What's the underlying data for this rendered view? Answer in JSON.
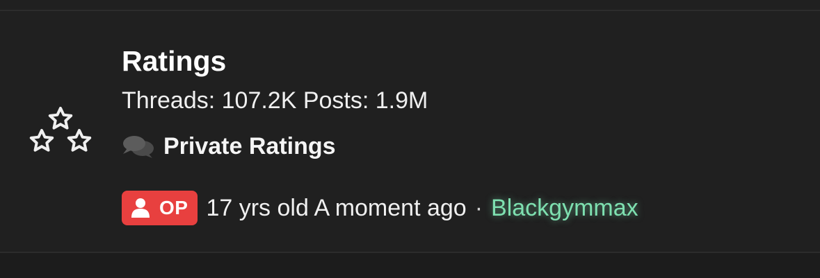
{
  "forum": {
    "title": "Ratings",
    "stats": "Threads: 107.2K Posts: 1.9M",
    "icon": "stars-icon",
    "subforum": {
      "icon": "chat-bubbles-icon",
      "label": "Private Ratings"
    },
    "last_post": {
      "badge_icon": "user-icon",
      "badge_label": "OP",
      "meta": "17 yrs old A moment ago",
      "separator": "·",
      "author": "Blackgymmax"
    }
  },
  "colors": {
    "background": "#202020",
    "text": "#ffffff",
    "badge": "#e8403f",
    "author": "#7ee0b0",
    "muted_icon": "#5a5a5a"
  }
}
